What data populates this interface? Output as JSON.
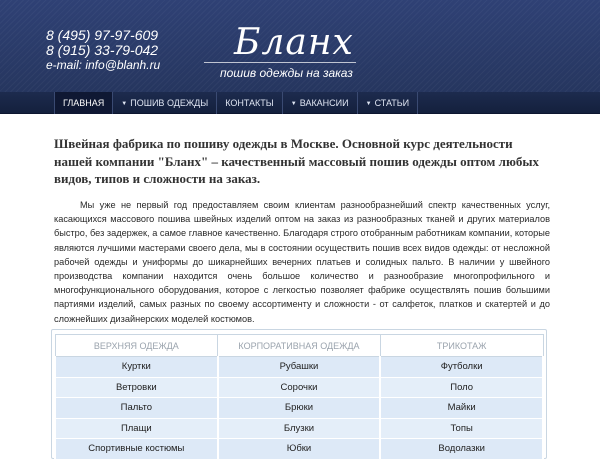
{
  "header": {
    "phone1": "8 (495) 97-97-609",
    "phone2": "8 (915) 33-79-042",
    "email": "e-mail:  info@blanh.ru",
    "logo_word": "Бланх",
    "logo_sub": "пошив одежды на заказ"
  },
  "nav": {
    "items": [
      {
        "label": "Главная",
        "dropdown": false,
        "active": true
      },
      {
        "label": "Пошив одежды",
        "dropdown": true,
        "active": false
      },
      {
        "label": "Контакты",
        "dropdown": false,
        "active": false
      },
      {
        "label": "Вакансии",
        "dropdown": true,
        "active": false
      },
      {
        "label": "Статьи",
        "dropdown": true,
        "active": false
      }
    ],
    "arrow": "▼"
  },
  "content": {
    "lead": "Швейная фабрика по пошиву одежды в Москве. Основной курс деятельности нашей компании \"Бланх\" – качественный массовый пошив одежды оптом любых видов, типов и сложности на заказ.",
    "body": "Мы уже не первый год предоставляем своим клиентам разнообразнейший спектр качественных услуг, касающихся массового пошива швейных изделий оптом на заказ из разнообразных тканей и других материалов быстро, без задержек, а самое главное качественно. Благодаря строго отобранным работникам компании, которые являются лучшими мастерами своего дела, мы в состоянии осуществить пошив всех видов одежды: от несложной рабочей одежды и униформы до шикарнейших вечерних платьев и солидных пальто. В наличии у швейного производства компании находится очень большое количество и разнообразие многопрофильного и многофункционального оборудования, которое с легкостью позволяет фабрике осуществлять пошив большими партиями изделий, самых разных по своему ассортименту и сложности - от салфеток, платков и скатертей и до сложнейших дизайнерских моделей костюмов."
  },
  "table": {
    "headers": [
      "Верхняя одежда",
      "Корпоративная одежда",
      "Трикотаж"
    ],
    "rows": [
      [
        "Куртки",
        "Рубашки",
        "Футболки"
      ],
      [
        "Ветровки",
        "Сорочки",
        "Поло"
      ],
      [
        "Пальто",
        "Брюки",
        "Майки"
      ],
      [
        "Плащи",
        "Блузки",
        "Топы"
      ],
      [
        "Спортивные костюмы",
        "Юбки",
        "Водолазки"
      ]
    ]
  }
}
